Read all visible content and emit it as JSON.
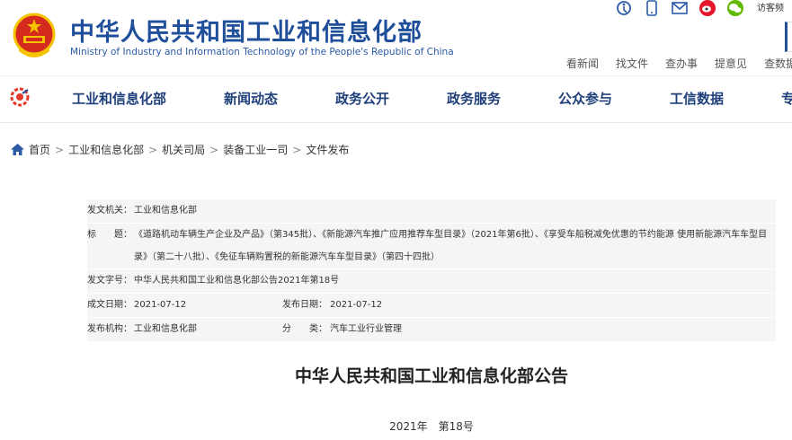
{
  "header": {
    "site_name_cn": "中华人民共和国工业和信息化部",
    "site_name_en": "Ministry of Industry and Information Technology of the People's Republic of China",
    "emblem_icon": "national-emblem-icon",
    "top_icons": [
      "accessibility-icon",
      "mobile-icon",
      "mail-icon",
      "weibo-icon",
      "wechat-icon"
    ],
    "guest_label": "访客频",
    "quick_links": [
      "看新闻",
      "找文件",
      "查办事",
      "提意见",
      "查数据"
    ]
  },
  "nav": {
    "logo_icon": "miit-logo-icon",
    "items": [
      "工业和信息化部",
      "新闻动态",
      "政务公开",
      "政务服务",
      "公众参与",
      "工信数据",
      "专"
    ]
  },
  "breadcrumb": {
    "home_icon": "home-icon",
    "items": [
      "首页",
      "工业和信息化部",
      "机关司局",
      "装备工业一司",
      "文件发布"
    ]
  },
  "info": {
    "issuer_label": "发文机关：",
    "issuer": "工业和信息化部",
    "title_label": "标　　题：",
    "title": "《道路机动车辆生产企业及产品》（第345批）、《新能源汽车推广应用推荐车型目录》（2021年第6批）、《享受车船税减免优惠的节约能源 使用新能源汽车车型目录》（第二十八批）、《免征车辆购置税的新能源汽车车型目录》（第四十四批）",
    "doc_no_label": "发文字号：",
    "doc_no": "中华人民共和国工业和信息化部公告2021年第18号",
    "created_label": "成文日期：",
    "created": "2021-07-12",
    "published_label": "发布日期：",
    "published": "2021-07-12",
    "org_label": "发布机构：",
    "org": "工业和信息化部",
    "category_label": "分　　类：",
    "category": "汽车工业行业管理"
  },
  "content": {
    "title": "中华人民共和国工业和信息化部公告",
    "number": "2021年　第18号"
  },
  "colors": {
    "brand": "#1f4e9b",
    "nav_text": "#1f3f7a",
    "emblem_red": "#d52b1e",
    "gold": "#f5c400"
  }
}
